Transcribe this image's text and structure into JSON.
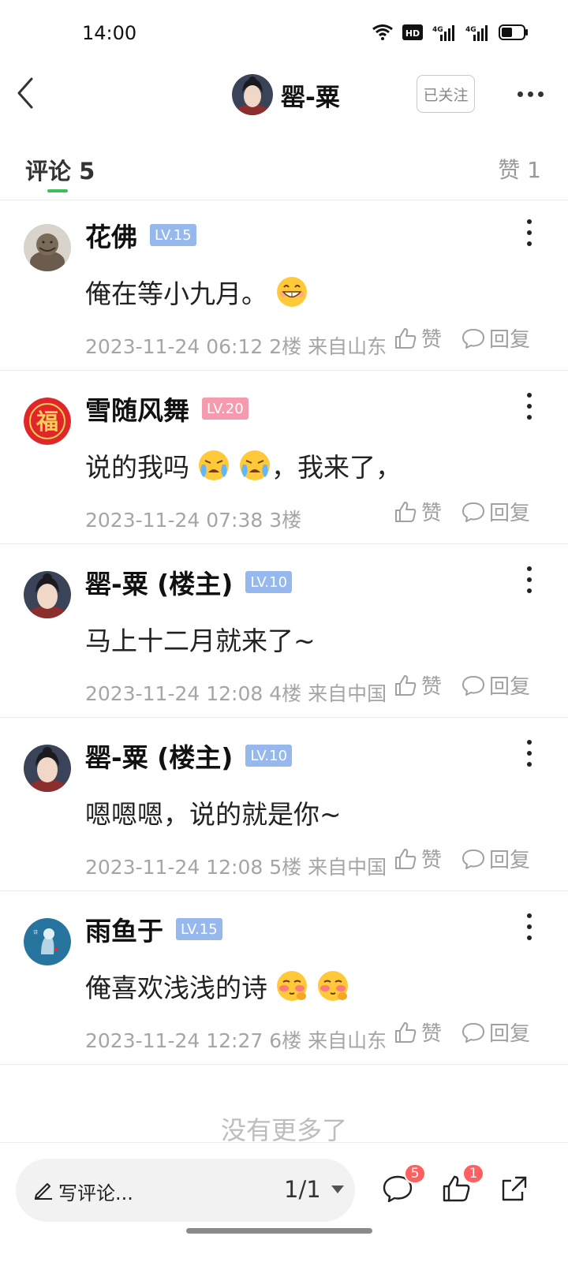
{
  "status_bar": {
    "time": "14:00",
    "network_labels": [
      "HD",
      "4G",
      "4G"
    ]
  },
  "nav": {
    "title": "罂-粟",
    "follow_label": "已关注",
    "icons": [
      "back-arrow-icon",
      "more-dots-icon"
    ]
  },
  "tabs": {
    "comments_label": "评论",
    "comments_count": "5",
    "likes_label": "赞",
    "likes_count": "1",
    "accent_color": "#3cbf5b"
  },
  "comments": [
    {
      "name": "花佛",
      "badge": "LV.15",
      "badge_color": "#96b8ec",
      "text": "俺在等小九月。",
      "emoji": [
        "grin-emoji"
      ],
      "date": "2023-11-24 06:12",
      "floor": "2楼",
      "location": "来自山东",
      "like_label": "赞",
      "reply_label": "回复"
    },
    {
      "name": "雪随风舞",
      "badge": "LV.20",
      "badge_color": "#f59bb0",
      "text": "说的我吗",
      "text_tail": "，我来了，",
      "emoji": [
        "crying-emoji",
        "crying-emoji"
      ],
      "date": "2023-11-24 07:38",
      "floor": "3楼",
      "location": "",
      "like_label": "赞",
      "reply_label": "回复"
    },
    {
      "name": "罂-粟 (楼主)",
      "badge": "LV.10",
      "badge_color": "#96b8ec",
      "text": "马上十二月就来了~",
      "emoji": [],
      "date": "2023-11-24 12:08",
      "floor": "4楼",
      "location": "来自中国",
      "like_label": "赞",
      "reply_label": "回复"
    },
    {
      "name": "罂-粟 (楼主)",
      "badge": "LV.10",
      "badge_color": "#96b8ec",
      "text": "嗯嗯嗯，说的就是你~",
      "emoji": [],
      "date": "2023-11-24 12:08",
      "floor": "5楼",
      "location": "来自中国",
      "like_label": "赞",
      "reply_label": "回复"
    },
    {
      "name": "雨鱼于",
      "badge": "LV.15",
      "badge_color": "#96b8ec",
      "text": "俺喜欢浅浅的诗",
      "emoji": [
        "shy-emoji",
        "shy-emoji"
      ],
      "date": "2023-11-24 12:27",
      "floor": "6楼",
      "location": "来自山东",
      "like_label": "赞",
      "reply_label": "回复"
    }
  ],
  "footer": {
    "no_more": "没有更多了"
  },
  "bottom_bar": {
    "write_placeholder": "写评论...",
    "page_indicator": "1/1",
    "comment_badge": "5",
    "like_badge": "1",
    "icons": [
      "pencil-icon",
      "comment-bubble-icon",
      "thumb-up-icon",
      "share-icon"
    ]
  }
}
